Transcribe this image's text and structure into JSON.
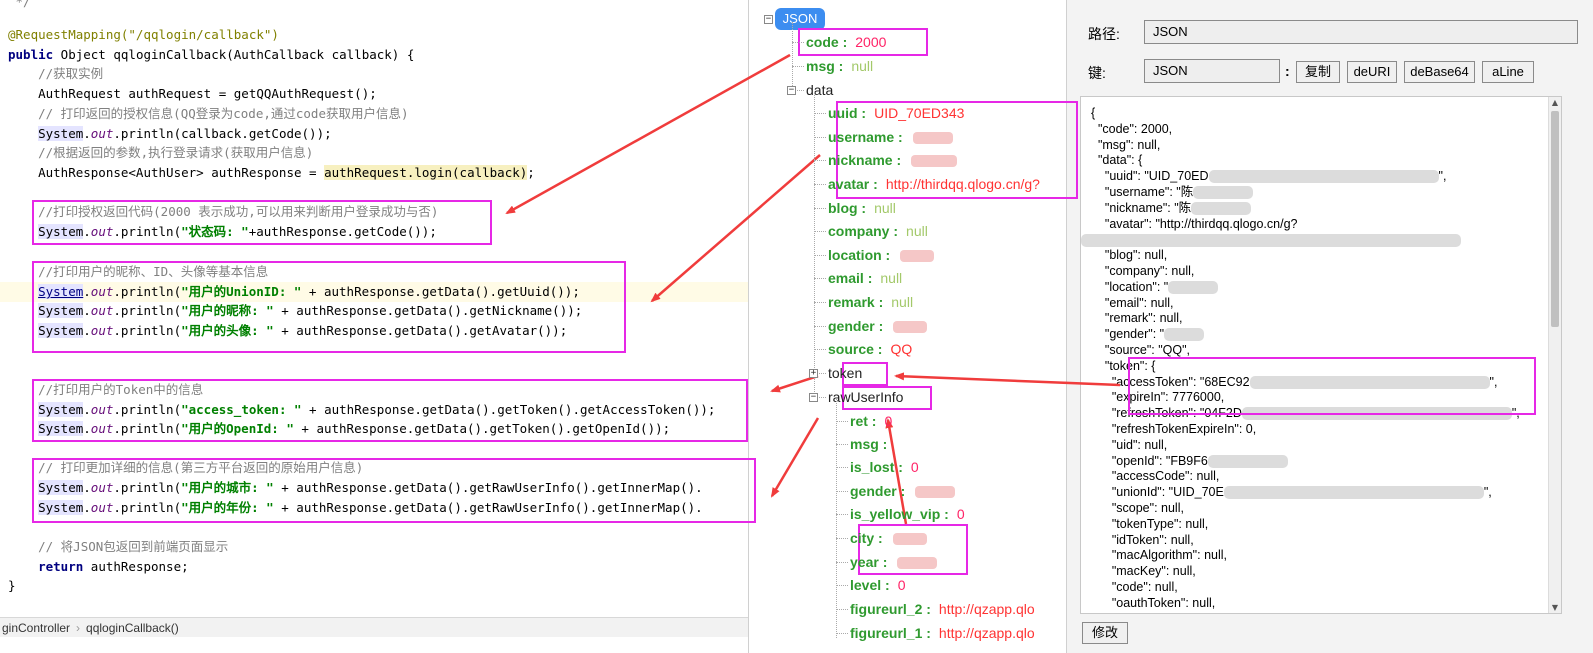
{
  "editor": {
    "lines": [
      {
        "type": "comment",
        "text": " */"
      },
      {
        "type": "annotation",
        "text": "@RequestMapping(\"/qqlogin/callback\")"
      },
      {
        "type": "signature",
        "kw": "public",
        "rest": " Object qqloginCallback(AuthCallback callback) {"
      },
      {
        "type": "comment",
        "text": "    //获取实例"
      },
      {
        "type": "code",
        "text": "    AuthRequest authRequest = getQQAuthRequest();"
      },
      {
        "type": "comment",
        "text": "    // 打印返回的授权信息(QQ登录为code,通过code获取用户信息)"
      },
      {
        "type": "println",
        "pre": "    ",
        "sys": "System",
        "out": "out",
        "rest": ".println(callback.getCode());"
      },
      {
        "type": "comment",
        "text": "    //根据返回的参数,执行登录请求(获取用户信息)"
      },
      {
        "type": "login",
        "pre": "    AuthResponse<AuthUser> authResponse = ",
        "call": "authRequest.login(callback)",
        "post": ";"
      },
      {
        "type": "comment",
        "text": "    //打印授权返回代码(2000 表示成功,可以用来判断用户登录成功与否)"
      },
      {
        "type": "printstr",
        "pre": "    ",
        "sys": "System",
        "out": "out",
        "mid": ".println(",
        "str": "\"状态码: \"",
        "rest": "+authResponse.getCode());"
      },
      {
        "type": "comment",
        "text": "    //打印用户的昵称、ID、头像等基本信息"
      },
      {
        "type": "printstr",
        "pre": "    ",
        "sys": "System",
        "out": "out",
        "mid": ".println(",
        "str": "\"用户的UnionID: \"",
        "rest": " + authResponse.getData().getUuid());"
      },
      {
        "type": "printstr",
        "pre": "    ",
        "sys": "System",
        "out": "out",
        "mid": ".println(",
        "str": "\"用户的昵称: \"",
        "rest": " + authResponse.getData().getNickname());"
      },
      {
        "type": "printstr",
        "pre": "    ",
        "sys": "System",
        "out": "out",
        "mid": ".println(",
        "str": "\"用户的头像: \"",
        "rest": " + authResponse.getData().getAvatar());"
      },
      {
        "type": "comment",
        "text": "    //打印用户的Token中的信息"
      },
      {
        "type": "printstr",
        "pre": "    ",
        "sys": "System",
        "out": "out",
        "mid": ".println(",
        "str": "\"access_token: \"",
        "rest": " + authResponse.getData().getToken().getAccessToken());"
      },
      {
        "type": "printstr",
        "pre": "    ",
        "sys": "System",
        "out": "out",
        "mid": ".println(",
        "str": "\"用户的OpenId: \"",
        "rest": " + authResponse.getData().getToken().getOpenId());"
      },
      {
        "type": "comment",
        "text": "    // 打印更加详细的信息(第三方平台返回的原始用户信息)"
      },
      {
        "type": "printstr",
        "pre": "    ",
        "sys": "System",
        "out": "out",
        "mid": ".println(",
        "str": "\"用户的城市: \"",
        "rest": " + authResponse.getData().getRawUserInfo().getInnerMap()."
      },
      {
        "type": "printstr",
        "pre": "    ",
        "sys": "System",
        "out": "out",
        "mid": ".println(",
        "str": "\"用户的年份: \"",
        "rest": " + authResponse.getData().getRawUserInfo().getInnerMap()."
      },
      {
        "type": "comment",
        "text": "    // 将JSON包返回到前端页面显示"
      },
      {
        "type": "return",
        "pre": "    ",
        "kw": "return",
        "rest": " authResponse;"
      },
      {
        "type": "code",
        "text": "}"
      }
    ],
    "breadcrumb": [
      "ginController",
      "qqloginCallback()"
    ]
  },
  "tree": {
    "root_label": "JSON",
    "nodes": [
      {
        "key": "code",
        "val": "2000",
        "vtype": "num"
      },
      {
        "key": "msg",
        "val": "null",
        "vtype": "null"
      },
      {
        "key": "data",
        "val": "",
        "vtype": "group"
      },
      {
        "key": "uuid",
        "val": "UID_70ED343",
        "vtype": "str"
      },
      {
        "key": "username",
        "val": "",
        "vtype": "blur"
      },
      {
        "key": "nickname",
        "val": "",
        "vtype": "blur"
      },
      {
        "key": "avatar",
        "val": "http://thirdqq.qlogo.cn/g?",
        "vtype": "str"
      },
      {
        "key": "blog",
        "val": "null",
        "vtype": "null"
      },
      {
        "key": "company",
        "val": "null",
        "vtype": "null"
      },
      {
        "key": "location",
        "val": "",
        "vtype": "blur"
      },
      {
        "key": "email",
        "val": "null",
        "vtype": "null"
      },
      {
        "key": "remark",
        "val": "null",
        "vtype": "null"
      },
      {
        "key": "gender",
        "val": "",
        "vtype": "blur"
      },
      {
        "key": "source",
        "val": "QQ",
        "vtype": "str"
      },
      {
        "key": "token",
        "val": "",
        "vtype": "collapsed"
      },
      {
        "key": "rawUserInfo",
        "val": "",
        "vtype": "group"
      },
      {
        "key": "ret",
        "val": "0",
        "vtype": "num"
      },
      {
        "key": "msg",
        "val": "",
        "vtype": "empty"
      },
      {
        "key": "is_lost",
        "val": "0",
        "vtype": "num"
      },
      {
        "key": "gender",
        "val": "",
        "vtype": "blur"
      },
      {
        "key": "is_yellow_vip",
        "val": "0",
        "vtype": "num"
      },
      {
        "key": "city",
        "val": "",
        "vtype": "blur"
      },
      {
        "key": "year",
        "val": "",
        "vtype": "blur"
      },
      {
        "key": "level",
        "val": "0",
        "vtype": "num"
      },
      {
        "key": "figureurl_2",
        "val": "http://qzapp.qlo",
        "vtype": "str"
      },
      {
        "key": "figureurl_1",
        "val": "http://qzapp.qlo",
        "vtype": "str"
      }
    ]
  },
  "panel": {
    "path_label": "路径:",
    "path_value": "JSON",
    "key_label": "键:",
    "key_value": "JSON",
    "colon": ":",
    "buttons": [
      "复制",
      "deURI",
      "deBase64",
      "aLine"
    ],
    "modify_label": "修改",
    "raw_lines": [
      {
        "text": "{"
      },
      {
        "text": "  \"code\": 2000,"
      },
      {
        "text": "  \"msg\": null,"
      },
      {
        "text": "  \"data\": {"
      },
      {
        "text": "    \"uuid\": \"UID_70ED",
        "tail": "\","
      },
      {
        "text": "    \"username\": \"陈",
        "tail": ""
      },
      {
        "text": "    \"nickname\": \"陈",
        "tail": ""
      },
      {
        "text": "    \"avatar\": \"http://thirdqq.qlogo.cn/g?"
      },
      {
        "text": "",
        "tail": ""
      },
      {
        "text": "    \"blog\": null,"
      },
      {
        "text": "    \"company\": null,"
      },
      {
        "text": "    \"location\": \"",
        "tail": ""
      },
      {
        "text": "    \"email\": null,"
      },
      {
        "text": "    \"remark\": null,"
      },
      {
        "text": "    \"gender\": \"",
        "tail": ""
      },
      {
        "text": "    \"source\": \"QQ\","
      },
      {
        "text": "    \"token\": {"
      },
      {
        "text": "      \"accessToken\": \"68EC92",
        "tail": "\","
      },
      {
        "text": "      \"expireIn\": 7776000,"
      },
      {
        "text": "      \"refreshToken\": \"04F2D",
        "tail": "\","
      },
      {
        "text": "      \"refreshTokenExpireIn\": 0,"
      },
      {
        "text": "      \"uid\": null,"
      },
      {
        "text": "      \"openId\": \"FB9F6",
        "tail": ""
      },
      {
        "text": "      \"accessCode\": null,"
      },
      {
        "text": "      \"unionId\": \"UID_70E",
        "tail": "\","
      },
      {
        "text": "      \"scope\": null,"
      },
      {
        "text": "      \"tokenType\": null,"
      },
      {
        "text": "      \"idToken\": null,"
      },
      {
        "text": "      \"macAlgorithm\": null,"
      },
      {
        "text": "      \"macKey\": null,"
      },
      {
        "text": "      \"code\": null,"
      },
      {
        "text": "      \"oauthToken\": null,"
      }
    ]
  },
  "colors": {
    "annotation_box": "#e628e6",
    "arrow": "#f03c3c",
    "json_root": "#3c8df0",
    "tree_key": "#2f9a2f"
  }
}
